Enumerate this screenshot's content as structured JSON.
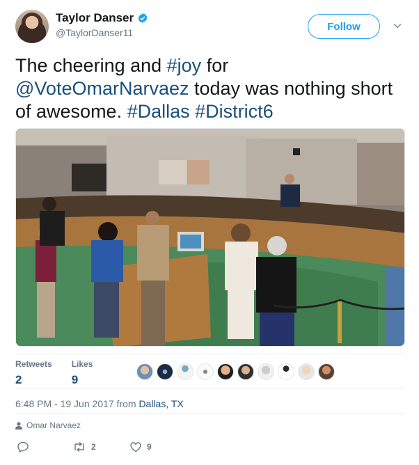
{
  "user": {
    "name": "Taylor Danser",
    "handle": "@TaylorDanser11",
    "follow_label": "Follow"
  },
  "tweet": {
    "text_1": "The cheering and ",
    "hashtag_joy": "#joy",
    "text_2": " for",
    "mention": "@VoteOmarNarvaez",
    "text_3": " today was nothing short of awesome. ",
    "hashtag_dallas": "#Dallas",
    "hashtag_district": "#District6"
  },
  "stats": {
    "retweets_label": "Retweets",
    "retweets_value": "2",
    "likes_label": "Likes",
    "likes_value": "9"
  },
  "meta": {
    "timestamp": "6:48 PM - 19 Jun 2017 from ",
    "location": "Dallas, TX"
  },
  "tagged": {
    "name": "Omar Narvaez"
  },
  "actions": {
    "retweet_count": "2",
    "like_count": "9"
  },
  "colors": {
    "accent": "#1da1f2",
    "link": "#1b4f7a",
    "secondary": "#657786"
  }
}
